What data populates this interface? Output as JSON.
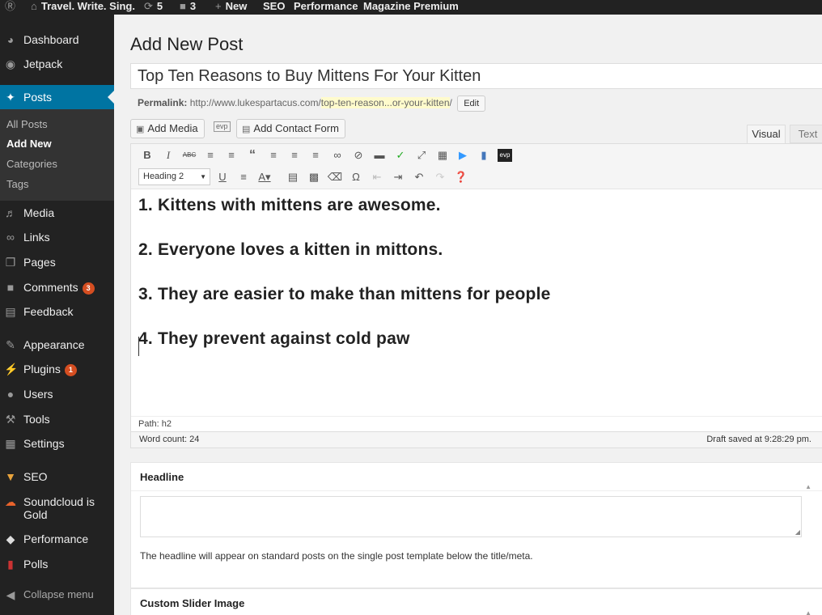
{
  "admin_bar": {
    "site_name": "Travel. Write. Sing.",
    "updates_count": "5",
    "comments_count": "3",
    "new_label": "New",
    "items": [
      "SEO",
      "Performance",
      "Magazine Premium"
    ]
  },
  "sidebar": {
    "items": [
      {
        "label": "Dashboard",
        "icon": "dashboard-icon"
      },
      {
        "label": "Jetpack",
        "icon": "jetpack-icon"
      },
      {
        "label": "Posts",
        "icon": "pin-icon"
      },
      {
        "label": "Media",
        "icon": "media-icon"
      },
      {
        "label": "Links",
        "icon": "link-icon"
      },
      {
        "label": "Pages",
        "icon": "pages-icon"
      },
      {
        "label": "Comments",
        "icon": "comments-icon",
        "badge": "3"
      },
      {
        "label": "Feedback",
        "icon": "feedback-icon"
      },
      {
        "label": "Appearance",
        "icon": "brush-icon"
      },
      {
        "label": "Plugins",
        "icon": "plug-icon",
        "badge": "1"
      },
      {
        "label": "Users",
        "icon": "user-icon"
      },
      {
        "label": "Tools",
        "icon": "wrench-icon"
      },
      {
        "label": "Settings",
        "icon": "settings-icon"
      },
      {
        "label": "SEO",
        "icon": "seo-icon"
      },
      {
        "label": "Soundcloud is Gold",
        "icon": "soundcloud-icon"
      },
      {
        "label": "Performance",
        "icon": "performance-icon"
      },
      {
        "label": "Polls",
        "icon": "polls-icon"
      }
    ],
    "posts_submenu": [
      "All Posts",
      "Add New",
      "Categories",
      "Tags"
    ],
    "collapse_label": "Collapse menu"
  },
  "page": {
    "title": "Add New Post",
    "post_title": "Top Ten Reasons to Buy Mittens For Your Kitten",
    "permalink_label": "Permalink:",
    "permalink_base": "http://www.lukespartacus.com/",
    "permalink_slug": "top-ten-reason...or-your-kitten",
    "permalink_trail": "/",
    "edit_label": "Edit",
    "add_media_label": "Add Media",
    "evp_label": "evp",
    "add_contact_form_label": "Add Contact Form",
    "tab_visual": "Visual",
    "tab_text": "Text"
  },
  "editor": {
    "format_select": "Heading 2",
    "headings": [
      "1. Kittens with mittens are awesome.",
      "2. Everyone loves a kitten in mittons.",
      "3. They are easier to make than mittens for people",
      "4. They prevent against cold paw"
    ],
    "path": "Path: h2",
    "word_count": "Word count: 24",
    "draft_saved": "Draft saved at 9:28:29 pm.",
    "toolbar_row2_hint": "Kama"
  },
  "metaboxes": {
    "headline_title": "Headline",
    "headline_desc": "The headline will appear on standard posts on the single post template below the title/meta.",
    "slider_title": "Custom Slider Image"
  },
  "colors": {
    "admin_bar": "#222222",
    "sidebar": "#222222",
    "active_menu": "#0074a2",
    "badge": "#d54e21"
  }
}
